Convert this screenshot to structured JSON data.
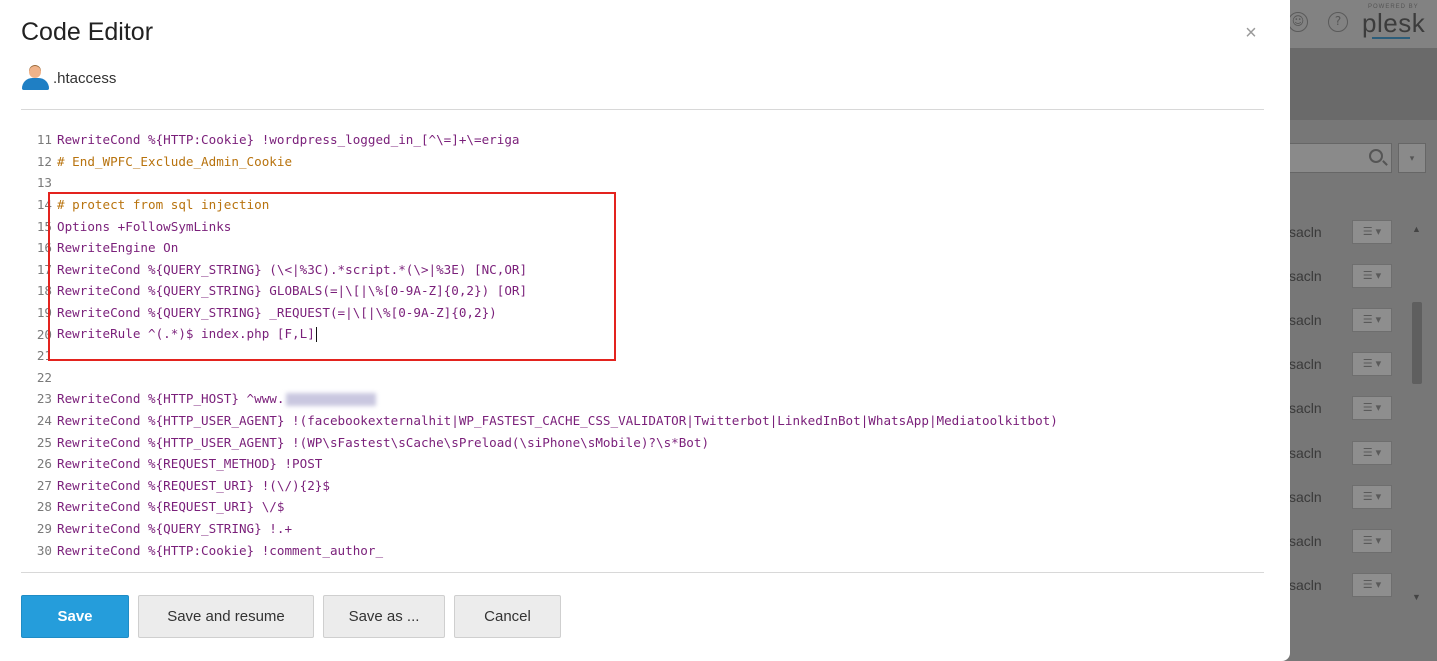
{
  "background": {
    "help_glyph": "?",
    "powered_by": "POWERED BY",
    "brand": "plesk",
    "row_labels": [
      "sacln",
      "sacln",
      "sacln",
      "sacln",
      "sacln",
      "sacln",
      "sacln",
      "sacln",
      "sacln"
    ],
    "row_button": "☰ ▾",
    "dropdown_glyph": "▾"
  },
  "dialog": {
    "title": "Code Editor",
    "close_glyph": "×",
    "file_name": ".htaccess",
    "accent_color": "#259ddb",
    "highlight_color": "#e3231e"
  },
  "editor": {
    "lines": [
      {
        "n": "11",
        "text": "RewriteCond %{HTTP:Cookie} !wordpress_logged_in_[^\\=]+\\=eriga",
        "kind": "k"
      },
      {
        "n": "12",
        "text": "# End_WPFC_Exclude_Admin_Cookie",
        "kind": "c"
      },
      {
        "n": "13",
        "text": "",
        "kind": "k"
      },
      {
        "n": "14",
        "text": "# protect from sql injection",
        "kind": "c"
      },
      {
        "n": "15",
        "text": "Options +FollowSymLinks",
        "kind": "k"
      },
      {
        "n": "16",
        "text": "RewriteEngine On",
        "kind": "k"
      },
      {
        "n": "17",
        "text": "RewriteCond %{QUERY_STRING} (\\<|%3C).*script.*(\\>|%3E) [NC,OR]",
        "kind": "k"
      },
      {
        "n": "18",
        "text": "RewriteCond %{QUERY_STRING} GLOBALS(=|\\[|\\%[0-9A-Z]{0,2}) [OR]",
        "kind": "k"
      },
      {
        "n": "19",
        "text": "RewriteCond %{QUERY_STRING} _REQUEST(=|\\[|\\%[0-9A-Z]{0,2})",
        "kind": "k"
      },
      {
        "n": "20",
        "text": "RewriteRule ^(.*)$ index.php [F,L]",
        "kind": "k"
      },
      {
        "n": "21",
        "text": "",
        "kind": "k"
      },
      {
        "n": "22",
        "text": "",
        "kind": "k"
      },
      {
        "n": "23",
        "text": "RewriteCond %{HTTP_HOST} ^www.",
        "kind": "k"
      },
      {
        "n": "24",
        "text": "RewriteCond %{HTTP_USER_AGENT} !(facebookexternalhit|WP_FASTEST_CACHE_CSS_VALIDATOR|Twitterbot|LinkedInBot|WhatsApp|Mediatoolkitbot)",
        "kind": "k"
      },
      {
        "n": "25",
        "text": "RewriteCond %{HTTP_USER_AGENT} !(WP\\sFastest\\sCache\\sPreload(\\siPhone\\sMobile)?\\s*Bot)",
        "kind": "k"
      },
      {
        "n": "26",
        "text": "RewriteCond %{REQUEST_METHOD} !POST",
        "kind": "k"
      },
      {
        "n": "27",
        "text": "RewriteCond %{REQUEST_URI} !(\\/){2}$",
        "kind": "k"
      },
      {
        "n": "28",
        "text": "RewriteCond %{REQUEST_URI} \\/$",
        "kind": "k"
      },
      {
        "n": "29",
        "text": "RewriteCond %{QUERY_STRING} !.+",
        "kind": "k"
      },
      {
        "n": "30",
        "text": "RewriteCond %{HTTP:Cookie} !comment_author_",
        "kind": "k"
      }
    ],
    "scroll_up_glyph": "▲",
    "scroll_down_glyph": "▼"
  },
  "buttons": {
    "save": "Save",
    "save_resume": "Save and resume",
    "save_as": "Save as ...",
    "cancel": "Cancel"
  }
}
